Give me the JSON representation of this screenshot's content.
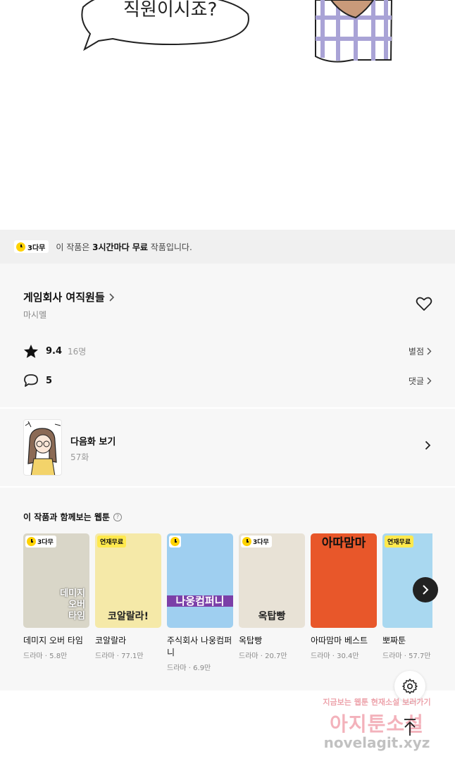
{
  "comic": {
    "speech_text": "직원이시죠?"
  },
  "notice": {
    "badge": "3다무",
    "text_prefix": "이 작품은 ",
    "text_bold": "3시간마다 무료",
    "text_suffix": " 작품입니다."
  },
  "series": {
    "title": "게임회사 여직원들",
    "author": "마시멜",
    "rating": "9.4",
    "rating_count": "16명",
    "rate_link": "별점",
    "comment_count": "5",
    "comment_link": "댓글"
  },
  "next_episode": {
    "label": "다음화 보기",
    "episode": "57화"
  },
  "recommendations": {
    "title": "이 작품과 함께보는 웹툰",
    "items": [
      {
        "name": "데미지 오버 타임",
        "genre": "드라마",
        "views": "5.8만",
        "badge": "3다무",
        "badge_type": "wait",
        "thumb_text": "데미지\n오버\n타임",
        "bg": "#d9d6c8"
      },
      {
        "name": "코알랄라",
        "genre": "드라마",
        "views": "77.1만",
        "badge": "연재무료",
        "badge_type": "free",
        "thumb_text": "코알랄라!",
        "bg": "#f5e9a8"
      },
      {
        "name": "주식회사 나웅컴퍼니",
        "genre": "드라마",
        "views": "6.9만",
        "badge": "",
        "badge_type": "wait-icon",
        "thumb_text": "나웅컴퍼니",
        "bg": "#9fcff0"
      },
      {
        "name": "옥탑빵",
        "genre": "드라마",
        "views": "20.7만",
        "badge": "3다무",
        "badge_type": "wait",
        "thumb_text": "옥탑빵",
        "bg": "#e8e2d6"
      },
      {
        "name": "아따맘마 베스트",
        "genre": "드라마",
        "views": "30.4만",
        "badge": "",
        "badge_type": "none",
        "thumb_text": "아따맘마",
        "bg": "#e8572a"
      },
      {
        "name": "뽀짜툰",
        "genre": "드라마",
        "views": "57.7만",
        "badge": "연재무료",
        "badge_type": "free",
        "thumb_text": "",
        "bg": "#a9d8f0"
      }
    ]
  },
  "watermark": {
    "line1": "지금보는 웹툰 현재소설 보러가기",
    "line2": "아지툰소설",
    "line3": "novelagit.xyz"
  },
  "colors": {
    "accent_yellow": "#ffd200",
    "free_badge": "#ffe94d"
  }
}
